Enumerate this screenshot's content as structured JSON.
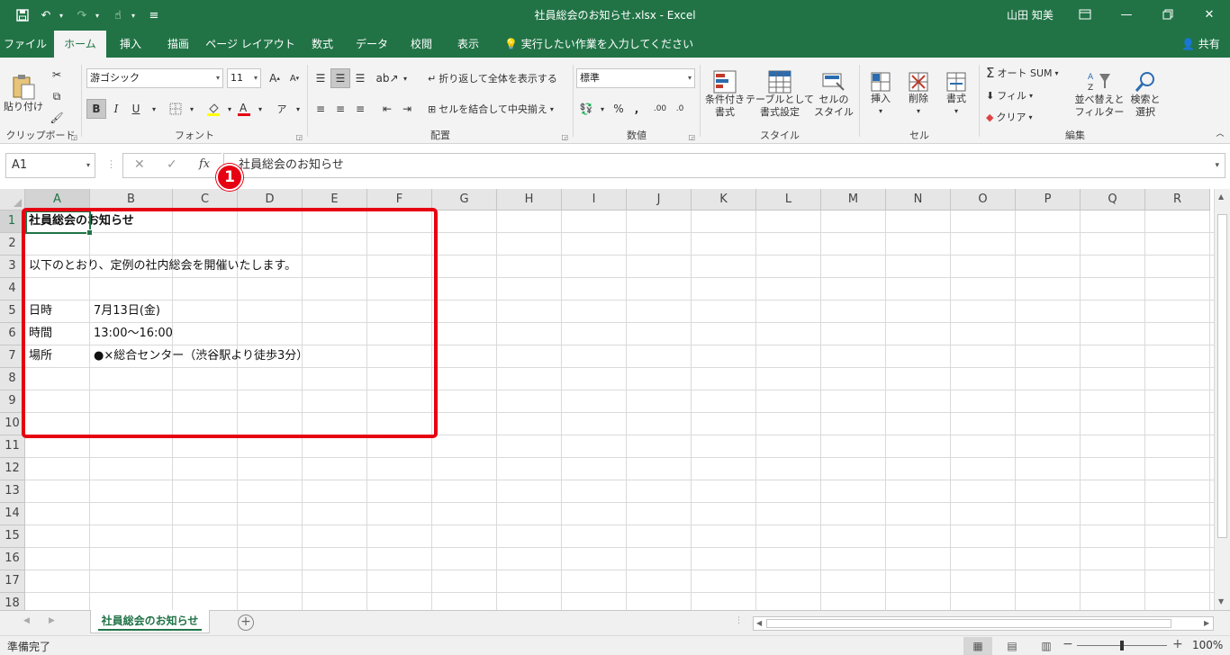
{
  "window": {
    "title": "社員総会のお知らせ.xlsx  -  Excel",
    "user": "山田 知美"
  },
  "tabs": {
    "items": [
      {
        "label": "ファイル"
      },
      {
        "label": "ホーム"
      },
      {
        "label": "挿入"
      },
      {
        "label": "描画"
      },
      {
        "label": "ページ レイアウト"
      },
      {
        "label": "数式"
      },
      {
        "label": "データ"
      },
      {
        "label": "校閲"
      },
      {
        "label": "表示"
      }
    ],
    "active": "ホーム",
    "tell_me": "実行したい作業を入力してください",
    "share": "共有"
  },
  "ribbon": {
    "clipboard": {
      "label": "クリップボード",
      "paste": "貼り付け"
    },
    "font": {
      "label": "フォント",
      "name": "游ゴシック",
      "size": "11",
      "bold": "B",
      "italic": "I",
      "underline": "U"
    },
    "alignment": {
      "label": "配置",
      "wrap": "折り返して全体を表示する",
      "merge": "セルを結合して中央揃え"
    },
    "number": {
      "label": "数値",
      "format": "標準"
    },
    "styles": {
      "label": "スタイル",
      "conditional": "条件付き\n書式",
      "table": "テーブルとして\n書式設定",
      "cell": "セルの\nスタイル"
    },
    "cells": {
      "label": "セル",
      "insert": "挿入",
      "delete": "削除",
      "format": "書式"
    },
    "editing": {
      "label": "編集",
      "autosum": "オート SUM",
      "fill": "フィル",
      "clear": "クリア",
      "sort": "並べ替えと\nフィルター",
      "find": "検索と\n選択"
    }
  },
  "formula_bar": {
    "name_box": "A1",
    "content": "社員総会のお知らせ"
  },
  "grid": {
    "columns": [
      "A",
      "B",
      "C",
      "D",
      "E",
      "F",
      "G",
      "H",
      "I",
      "J",
      "K",
      "L",
      "M",
      "N",
      "O",
      "P",
      "Q",
      "R"
    ],
    "rows": [
      "1",
      "2",
      "3",
      "4",
      "5",
      "6",
      "7",
      "8",
      "9",
      "10",
      "11",
      "12",
      "13",
      "14",
      "15",
      "16",
      "17",
      "18"
    ],
    "cells": {
      "a1": "社員総会のお知らせ",
      "a3": "以下のとおり、定例の社内総会を開催いたします。",
      "a5": "日時",
      "b5": "7月13日(金)",
      "a6": "時間",
      "b6": "13:00～16:00",
      "a7": "場所",
      "b7": "●×総合センター（渋谷駅より徒歩3分）"
    },
    "annotation_marker": "1",
    "annotation_color": "#e60012"
  },
  "sheets": {
    "active": "社員総会のお知らせ"
  },
  "status": {
    "ready": "準備完了",
    "zoom": "100%"
  },
  "colors": {
    "accent": "#217346"
  }
}
